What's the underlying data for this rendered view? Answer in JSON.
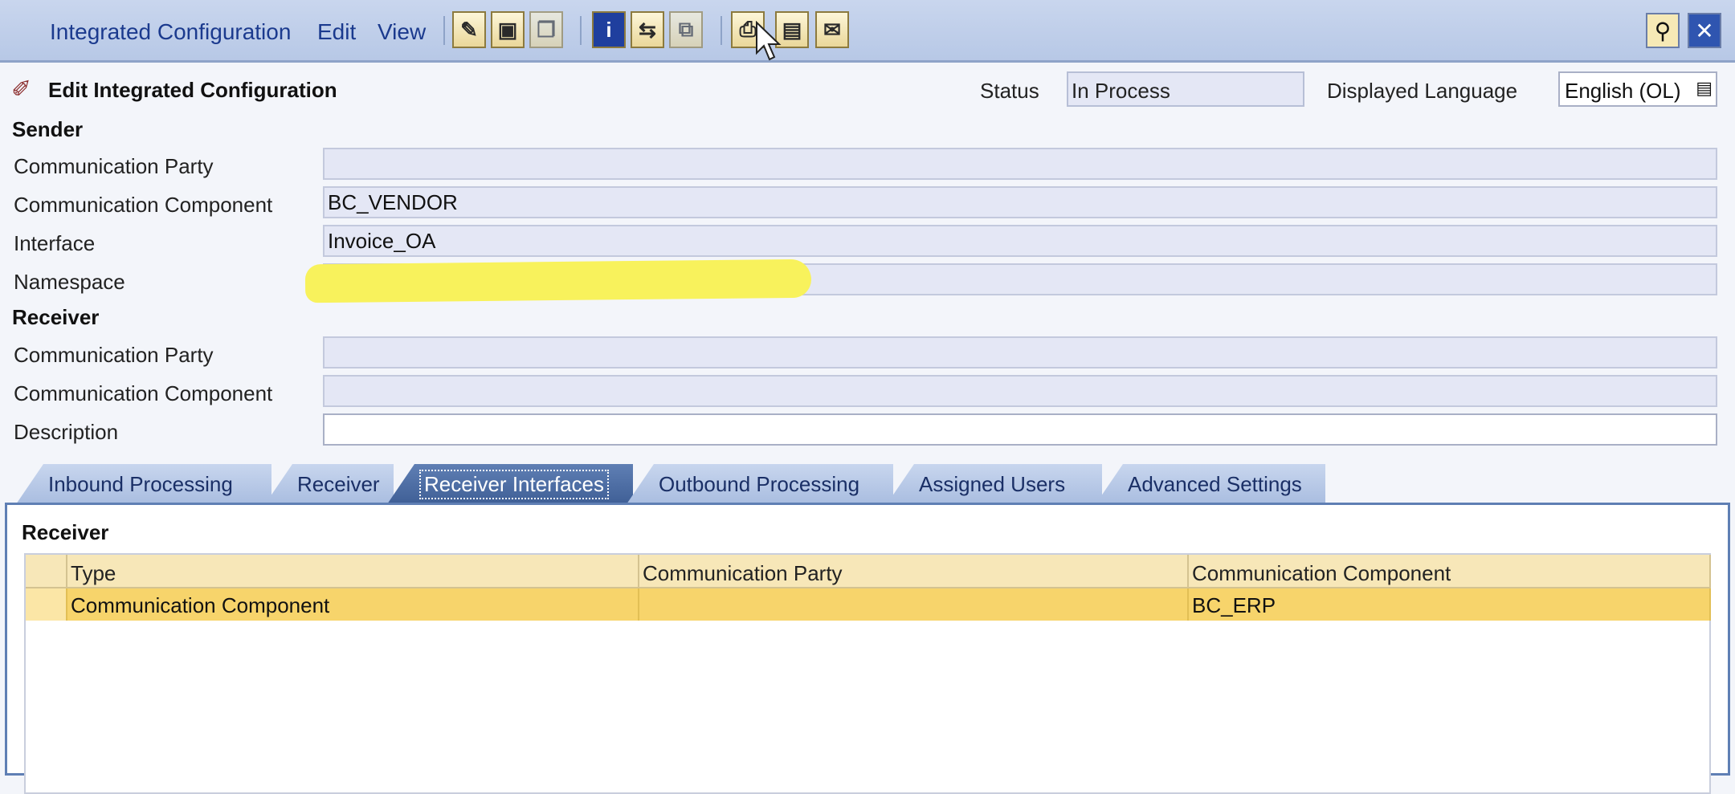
{
  "menu": {
    "integrated_configuration": "Integrated Configuration",
    "edit": "Edit",
    "view": "View"
  },
  "toolbar": {
    "icons": [
      "edit-icon",
      "save-icon",
      "copy-icon",
      "info-icon",
      "navigate-icon",
      "compare-icon",
      "print-icon",
      "table-icon",
      "script-icon"
    ]
  },
  "header": {
    "title": "Edit Integrated Configuration",
    "status_label": "Status",
    "status_value": "In Process",
    "language_label": "Displayed Language",
    "language_value": "English (OL)"
  },
  "sender": {
    "heading": "Sender",
    "party_label": "Communication Party",
    "party_value": "",
    "component_label": "Communication Component",
    "component_value": "BC_VENDOR",
    "interface_label": "Interface",
    "interface_value": "Invoice_OA",
    "namespace_label": "Namespace",
    "namespace_value": ""
  },
  "receiver": {
    "heading": "Receiver",
    "party_label": "Communication Party",
    "party_value": "",
    "component_label": "Communication Component",
    "component_value": "",
    "description_label": "Description",
    "description_value": ""
  },
  "tabs": [
    {
      "label": "Inbound Processing"
    },
    {
      "label": "Receiver"
    },
    {
      "label": "Receiver Interfaces"
    },
    {
      "label": "Outbound Processing"
    },
    {
      "label": "Assigned Users"
    },
    {
      "label": "Advanced Settings"
    }
  ],
  "panel": {
    "heading": "Receiver",
    "columns": [
      "Type",
      "Communication Party",
      "Communication Component"
    ],
    "rows": [
      {
        "type": "Communication Component",
        "party": "",
        "component": "BC_ERP"
      }
    ]
  },
  "colors": {
    "menubar": "#c9d6ee",
    "active_tab": "#4f6fa6",
    "selected_row": "#f7d46b",
    "highlight_marker": "#f8f25c"
  }
}
